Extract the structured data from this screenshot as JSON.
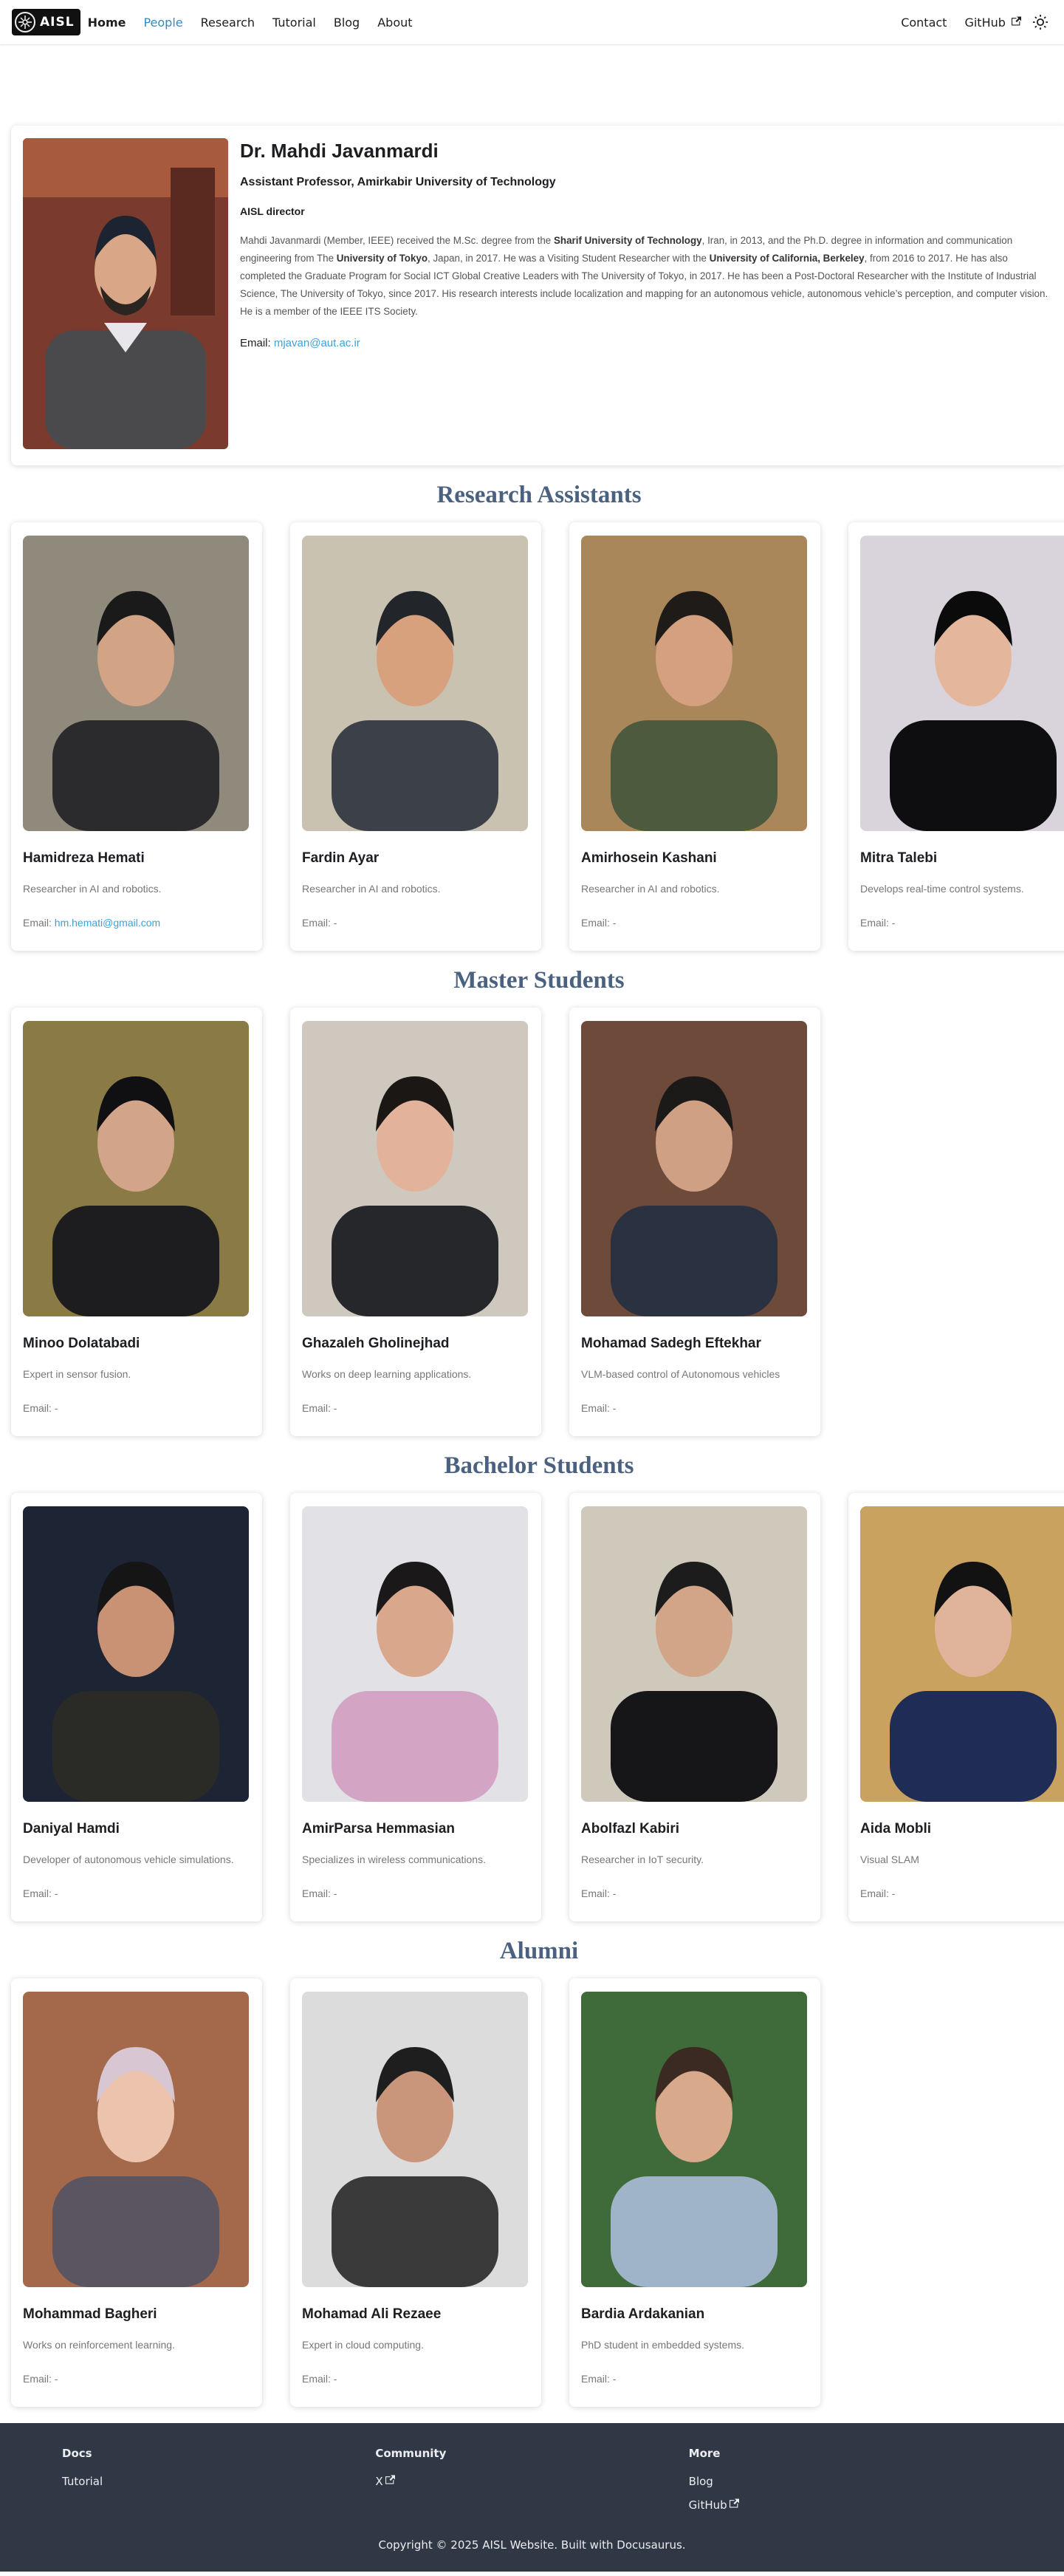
{
  "nav": {
    "logo_text": "AISL",
    "links": [
      {
        "label": "Home"
      },
      {
        "label": "People"
      },
      {
        "label": "Research"
      },
      {
        "label": "Tutorial"
      },
      {
        "label": "Blog"
      },
      {
        "label": "About"
      }
    ],
    "right": {
      "contact": "Contact",
      "github": "GitHub"
    },
    "theme_icon": "sun-icon"
  },
  "director": {
    "name": "Dr. Mahdi Javanmardi",
    "role": "Assistant Professor, Amirkabir University of Technology",
    "tag": "AISL director",
    "bio": {
      "p1": "Mahdi Javanmardi (Member, IEEE) received the M.Sc. degree from the ",
      "b1": "Sharif University of Technology",
      "p2": ", Iran, in 2013, and the Ph.D. degree in information and communication engineering from The ",
      "b2": "University of Tokyo",
      "p3": ", Japan, in 2017. He was a Visiting Student Researcher with the ",
      "b3": "University of California, Berkeley",
      "p4": ", from 2016 to 2017. He has also completed the Graduate Program for Social ICT Global Creative Leaders with The University of Tokyo, in 2017. He has been a Post-Doctoral Researcher with the Institute of Industrial Science, The University of Tokyo, since 2017. His research interests include localization and mapping for an autonomous vehicle, autonomous vehicle’s perception, and computer vision. He is a member of the IEEE ITS Society."
    },
    "email_label": "Email:",
    "email": "mjavan@aut.ac.ir"
  },
  "sections": [
    {
      "title": "Research Assistants",
      "members": [
        {
          "name": "Hamidreza Hemati",
          "desc": "Researcher in AI and robotics.",
          "email_label": "Email:",
          "email": "hm.hemati@gmail.com"
        },
        {
          "name": "Fardin Ayar",
          "desc": "Researcher in AI and robotics.",
          "email_label": "Email:",
          "email": "-"
        },
        {
          "name": "Amirhosein Kashani",
          "desc": "Researcher in AI and robotics.",
          "email_label": "Email:",
          "email": "-"
        },
        {
          "name": "Mitra Talebi",
          "desc": "Develops real-time control systems.",
          "email_label": "Email:",
          "email": "-"
        }
      ]
    },
    {
      "title": "Master Students",
      "members": [
        {
          "name": "Minoo Dolatabadi",
          "desc": "Expert in sensor fusion.",
          "email_label": "Email:",
          "email": "-"
        },
        {
          "name": "Ghazaleh Gholinejhad",
          "desc": "Works on deep learning applications.",
          "email_label": "Email:",
          "email": "-"
        },
        {
          "name": "Mohamad Sadegh Eftekhar",
          "desc": "VLM-based control of Autonomous vehicles",
          "email_label": "Email:",
          "email": "-"
        }
      ]
    },
    {
      "title": "Bachelor Students",
      "members": [
        {
          "name": "Daniyal Hamdi",
          "desc": "Developer of autonomous vehicle simulations.",
          "email_label": "Email:",
          "email": "-"
        },
        {
          "name": "AmirParsa Hemmasian",
          "desc": "Specializes in wireless communications.",
          "email_label": "Email:",
          "email": "-"
        },
        {
          "name": "Abolfazl Kabiri",
          "desc": "Researcher in IoT security.",
          "email_label": "Email:",
          "email": "-"
        },
        {
          "name": "Aida Mobli",
          "desc": "Visual SLAM",
          "email_label": "Email:",
          "email": "-"
        }
      ]
    },
    {
      "title": "Alumni",
      "members": [
        {
          "name": "Mohammad Bagheri",
          "desc": "Works on reinforcement learning.",
          "email_label": "Email:",
          "email": "-"
        },
        {
          "name": "Mohamad Ali Rezaee",
          "desc": "Expert in cloud computing.",
          "email_label": "Email:",
          "email": "-"
        },
        {
          "name": "Bardia Ardakanian",
          "desc": "PhD student in embedded systems.",
          "email_label": "Email:",
          "email": "-"
        }
      ]
    }
  ],
  "footer": {
    "columns": [
      {
        "title": "Docs",
        "links": [
          "Tutorial"
        ]
      },
      {
        "title": "Community",
        "links": [
          "X"
        ]
      },
      {
        "title": "More",
        "links": [
          "Blog",
          "GitHub"
        ]
      }
    ],
    "copyright": "Copyright © 2025 AISL Website. Built with Docusaurus."
  },
  "colors": {
    "accent": "#2e8bc6",
    "section_title": "#4a6280",
    "footer_bg": "#303846"
  }
}
